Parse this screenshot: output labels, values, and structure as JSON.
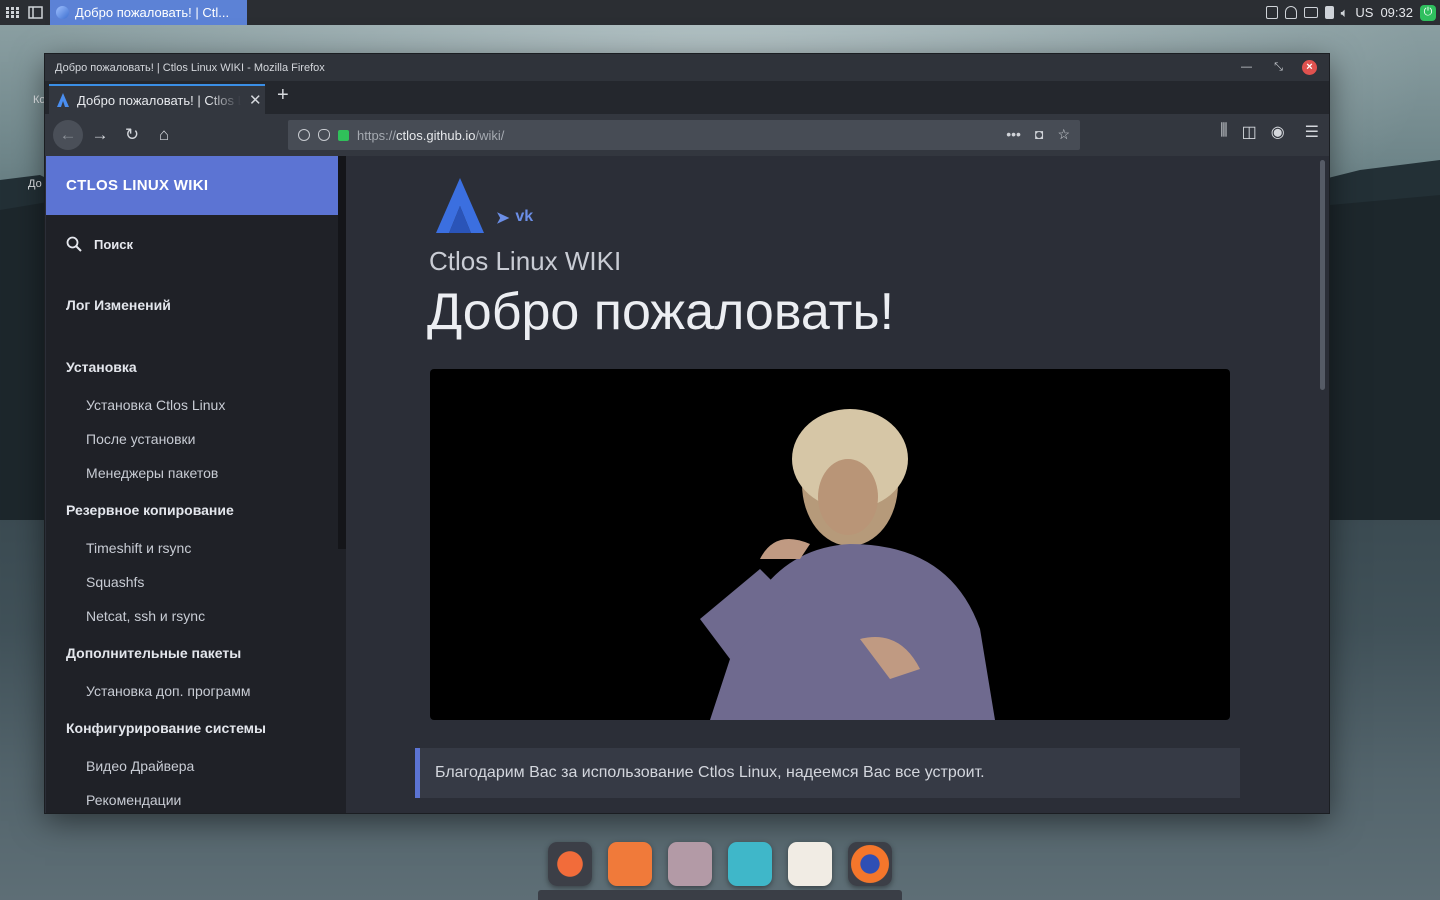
{
  "panel": {
    "task_title": "Добро пожаловать! | Ctl...",
    "keyboard_layout": "US",
    "clock": "09:32"
  },
  "desktop": {
    "frag1": "Ко",
    "frag2": "До"
  },
  "window": {
    "title": "Добро пожаловать! | Ctlos Linux WIKI - Mozilla Firefox",
    "tab_title": "Добро пожаловать! | Ctlos Linux WIKI",
    "url_protocol": "https://",
    "url_host": "ctlos.github.io",
    "url_path": "/wiki/"
  },
  "sidebar": {
    "header": "CTLOS LINUX WIKI",
    "search_label": "Поиск",
    "sections": [
      {
        "label": "Лог Изменений"
      },
      {
        "label": "Установка"
      },
      {
        "label": "Установка Ctlos Linux"
      },
      {
        "label": "После установки"
      },
      {
        "label": "Менеджеры пакетов"
      },
      {
        "label": "Резервное копирование"
      },
      {
        "label": "Timeshift и rsync"
      },
      {
        "label": "Squashfs"
      },
      {
        "label": "Netcat, ssh и rsync"
      },
      {
        "label": "Дополнительные пакеты"
      },
      {
        "label": "Установка доп. программ"
      },
      {
        "label": "Конфигурирование системы"
      },
      {
        "label": "Видео Драйвера"
      },
      {
        "label": "Рекомендации"
      }
    ]
  },
  "main": {
    "site_name": "Ctlos Linux WIKI",
    "heading": "Добро пожаловать!",
    "social": {
      "telegram": "➤",
      "vk": "vk"
    },
    "note": "Благодарим Вас за использование Ctlos Linux, надеемся Вас все устроит."
  },
  "icons": [
    "apps-grid-icon",
    "desktop-icon",
    "clipboard-icon",
    "shield-icon",
    "display-icon",
    "battery-icon",
    "volume-icon",
    "power-icon"
  ],
  "colors": {
    "accent": "#5c74d3",
    "task": "#5c82d6",
    "lock": "#30c05a",
    "close": "#e0524f"
  }
}
